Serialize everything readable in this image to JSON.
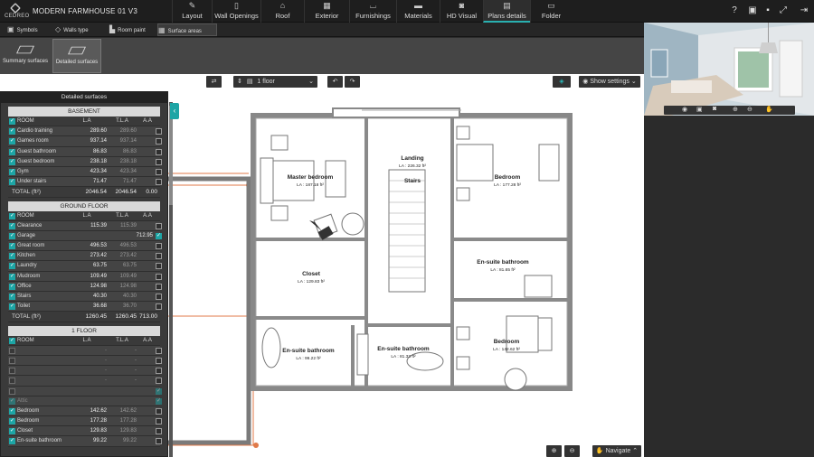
{
  "app": {
    "logo_text": "CEDREO",
    "project_title": "MODERN FARMHOUSE 01 V3"
  },
  "nav": [
    {
      "label": "Layout",
      "icon": "layout-icon"
    },
    {
      "label": "Wall Openings",
      "icon": "door-icon"
    },
    {
      "label": "Roof",
      "icon": "roof-icon"
    },
    {
      "label": "Exterior",
      "icon": "exterior-icon"
    },
    {
      "label": "Furnishings",
      "icon": "armchair-icon"
    },
    {
      "label": "Materials",
      "icon": "paint-roller-icon"
    },
    {
      "label": "HD Visual",
      "icon": "camera-icon"
    },
    {
      "label": "Plans details",
      "icon": "plans-icon"
    },
    {
      "label": "Folder",
      "icon": "folder-icon"
    }
  ],
  "subtabs": [
    {
      "label": "Symbols"
    },
    {
      "label": "Walls type"
    },
    {
      "label": "Room paint"
    },
    {
      "label": "Surface areas"
    }
  ],
  "modes": [
    {
      "label": "Summary surfaces"
    },
    {
      "label": "Detailed surfaces"
    }
  ],
  "toolbar": {
    "floor_select": "1 floor",
    "show_settings": "Show settings",
    "navigate": "Navigate"
  },
  "panel": {
    "title": "Detailed surfaces",
    "col_room": "ROOM",
    "col_la": "L.A",
    "col_tla": "T.L.A",
    "col_aa": "A.A",
    "basement": {
      "title": "BASEMENT",
      "rows": [
        {
          "name": "Cardio training",
          "la": "289.60",
          "tla": "289.60",
          "aa": ""
        },
        {
          "name": "Games room",
          "la": "937.14",
          "tla": "937.14",
          "aa": ""
        },
        {
          "name": "Guest bathroom",
          "la": "86.83",
          "tla": "86.83",
          "aa": ""
        },
        {
          "name": "Guest bedroom",
          "la": "238.18",
          "tla": "238.18",
          "aa": ""
        },
        {
          "name": "Gym",
          "la": "423.34",
          "tla": "423.34",
          "aa": ""
        },
        {
          "name": "Under stairs",
          "la": "71.47",
          "tla": "71.47",
          "aa": ""
        }
      ],
      "total_label": "TOTAL (ft²)",
      "total_la": "2046.54",
      "total_tla": "2046.54",
      "total_aa": "0.00"
    },
    "ground": {
      "title": "GROUND FLOOR",
      "rows": [
        {
          "name": "Clearance",
          "la": "115.39",
          "tla": "115.39",
          "aa": ""
        },
        {
          "name": "Garage",
          "la": "",
          "tla": "",
          "aa": "712.95"
        },
        {
          "name": "Great room",
          "la": "496.53",
          "tla": "496.53",
          "aa": ""
        },
        {
          "name": "Kitchen",
          "la": "273.42",
          "tla": "273.42",
          "aa": ""
        },
        {
          "name": "Laundry",
          "la": "63.75",
          "tla": "63.75",
          "aa": ""
        },
        {
          "name": "Mudroom",
          "la": "109.49",
          "tla": "109.49",
          "aa": ""
        },
        {
          "name": "Office",
          "la": "124.98",
          "tla": "124.98",
          "aa": ""
        },
        {
          "name": "Stairs",
          "la": "40.30",
          "tla": "40.30",
          "aa": ""
        },
        {
          "name": "Toilet",
          "la": "36.68",
          "tla": "36.70",
          "aa": ""
        }
      ],
      "total_label": "TOTAL (ft²)",
      "total_la": "1260.45",
      "total_tla": "1260.45",
      "total_aa": "713.00"
    },
    "first": {
      "title": "1 FLOOR",
      "rows": [
        {
          "name": "",
          "la": "-",
          "tla": "-",
          "aa": ""
        },
        {
          "name": "",
          "la": "-",
          "tla": "-",
          "aa": ""
        },
        {
          "name": "",
          "la": "-",
          "tla": "-",
          "aa": ""
        },
        {
          "name": "",
          "la": "-",
          "tla": "-",
          "aa": ""
        },
        {
          "name": "",
          "la": "",
          "tla": "",
          "aa": ""
        },
        {
          "name": "Attic",
          "la": "",
          "tla": "",
          "aa": ""
        },
        {
          "name": "Bedroom",
          "la": "142.62",
          "tla": "142.62",
          "aa": ""
        },
        {
          "name": "Bedroom",
          "la": "177.28",
          "tla": "177.28",
          "aa": ""
        },
        {
          "name": "Closet",
          "la": "129.83",
          "tla": "129.83",
          "aa": ""
        },
        {
          "name": "En-suite bathroom",
          "la": "99.22",
          "tla": "99.22",
          "aa": ""
        }
      ]
    }
  },
  "plan": {
    "rooms": [
      {
        "name": "Master bedroom",
        "area": "LA : 187.18 ft²"
      },
      {
        "name": "Landing",
        "area": "LA : 226.32 ft²"
      },
      {
        "name": "Stairs",
        "area": ""
      },
      {
        "name": "Bedroom",
        "area": "LA : 177.28 ft²"
      },
      {
        "name": "Closet",
        "area": "LA : 129.83 ft²"
      },
      {
        "name": "En-suite bathroom",
        "area": "LA : 81.65 ft²"
      },
      {
        "name": "En-suite bathroom",
        "area": "LA : 99.22 ft²"
      },
      {
        "name": "En-suite bathroom",
        "area": "LA : 81.33 ft²"
      },
      {
        "name": "Bedroom",
        "area": "LA : 142.62 ft²"
      }
    ]
  }
}
